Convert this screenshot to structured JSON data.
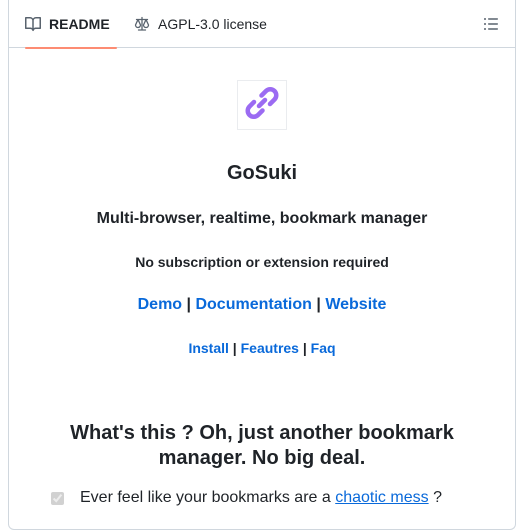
{
  "tabs": {
    "readme": {
      "label": "README",
      "icon": "book-icon"
    },
    "license": {
      "label": "AGPL-3.0 license",
      "icon": "law-icon"
    },
    "outline_icon": "list-unordered-icon"
  },
  "colors": {
    "accent_underline": "#fd8c73",
    "link": "#0969da",
    "border": "#d0d7de"
  },
  "readme": {
    "logo_icon": "link-icon",
    "title": "GoSuki",
    "subtitle": "Multi-browser, realtime, bookmark manager",
    "tagline": "No subscription or extension required",
    "links_primary": [
      {
        "label": "Demo"
      },
      {
        "label": "Documentation"
      },
      {
        "label": "Website"
      }
    ],
    "links_secondary": [
      {
        "label": "Install"
      },
      {
        "label": "Feautres"
      },
      {
        "label": "Faq"
      }
    ],
    "separator": "|",
    "heading": "What's this ? Oh, just another bookmark manager. No big deal.",
    "task": {
      "checked": true,
      "text_before": "Ever feel like your bookmarks are a",
      "link": "chaotic mess",
      "text_after": "?"
    }
  }
}
